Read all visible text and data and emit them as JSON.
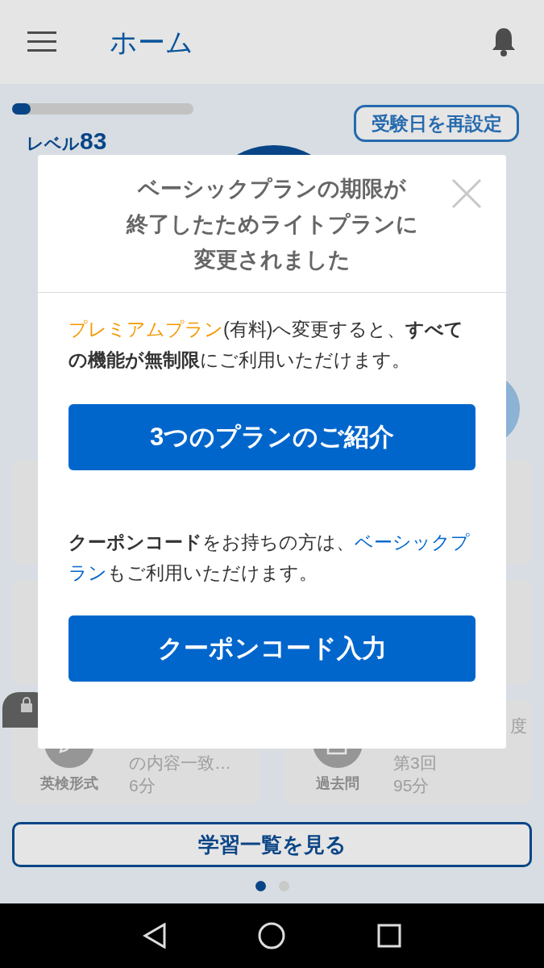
{
  "header": {
    "title": "ホーム"
  },
  "progress": {
    "level": 0.1
  },
  "reset_button": "受験日を再設定",
  "level_label": {
    "prefix": "レベル",
    "value": "83"
  },
  "cards": [
    {
      "kind": "empty"
    },
    {
      "kind": "empty"
    },
    {
      "kind": "empty"
    },
    {
      "kind": "empty"
    },
    {
      "kind": "writing",
      "locked": true,
      "label": "英検形式",
      "lines": [
        "の内容一致…",
        "6分"
      ]
    },
    {
      "kind": "past",
      "locked": false,
      "label": "過去問",
      "corner": "度",
      "lines": [
        "第3回",
        "95分"
      ]
    }
  ],
  "list_button": "学習一覧を見る",
  "page_dots": [
    {
      "selected": true
    },
    {
      "selected": false
    }
  ],
  "modal": {
    "title_lines": [
      "ベーシックプランの期限が",
      "終了したためライトプランに",
      "変更されました"
    ],
    "paragraph_1": [
      {
        "kind": "accent",
        "text": "プレミアムプラン"
      },
      {
        "kind": "plain",
        "text": "(有料)へ変更すると、"
      },
      {
        "kind": "strong",
        "text": "すべての機能が無制限"
      },
      {
        "kind": "plain",
        "text": "にご利用いただけます。"
      }
    ],
    "plans_button": "3つのプランのご紹介",
    "paragraph_2": [
      {
        "kind": "strong",
        "text": "クーポンコード"
      },
      {
        "kind": "plain",
        "text": "をお持ちの方は、"
      },
      {
        "kind": "link",
        "text": "ベーシックプラン"
      },
      {
        "kind": "plain",
        "text": "もご利用いただけます。"
      }
    ],
    "coupon_button": "クーポンコード入力"
  }
}
